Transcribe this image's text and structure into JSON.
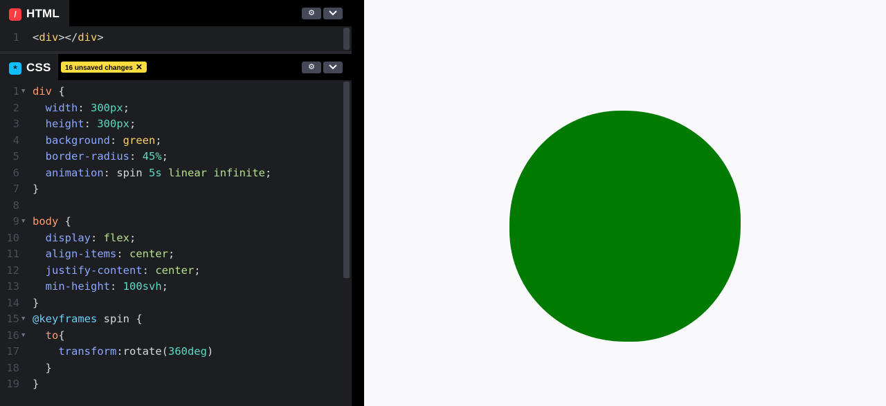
{
  "html_panel": {
    "title": "HTML",
    "icon": "html-icon",
    "lines": [
      {
        "n": "1",
        "tokens": [
          [
            "tag",
            "<"
          ],
          [
            "tagname",
            "div"
          ],
          [
            "tag",
            "></"
          ],
          [
            "tagname",
            "div"
          ],
          [
            "tag",
            ">"
          ]
        ]
      }
    ]
  },
  "css_panel": {
    "title": "CSS",
    "icon": "css-icon",
    "unsaved_label": "16 unsaved changes",
    "lines": [
      {
        "n": "1",
        "fold": true,
        "tokens": [
          [
            "sel",
            "div"
          ],
          [
            "tag",
            " {"
          ]
        ]
      },
      {
        "n": "2",
        "tokens": [
          [
            "tag",
            "  "
          ],
          [
            "prop",
            "width"
          ],
          [
            "tag",
            ": "
          ],
          [
            "num",
            "300px"
          ],
          [
            "tag",
            ";"
          ]
        ]
      },
      {
        "n": "3",
        "tokens": [
          [
            "tag",
            "  "
          ],
          [
            "prop",
            "height"
          ],
          [
            "tag",
            ": "
          ],
          [
            "num",
            "300px"
          ],
          [
            "tag",
            ";"
          ]
        ]
      },
      {
        "n": "4",
        "tokens": [
          [
            "tag",
            "  "
          ],
          [
            "prop",
            "background"
          ],
          [
            "tag",
            ": "
          ],
          [
            "val",
            "green"
          ],
          [
            "tag",
            ";"
          ]
        ]
      },
      {
        "n": "5",
        "tokens": [
          [
            "tag",
            "  "
          ],
          [
            "prop",
            "border-radius"
          ],
          [
            "tag",
            ": "
          ],
          [
            "num",
            "45%"
          ],
          [
            "tag",
            ";"
          ]
        ]
      },
      {
        "n": "6",
        "tokens": [
          [
            "tag",
            "  "
          ],
          [
            "prop",
            "animation"
          ],
          [
            "tag",
            ": spin "
          ],
          [
            "num",
            "5s"
          ],
          [
            "tag",
            " "
          ],
          [
            "kw",
            "linear"
          ],
          [
            "tag",
            " "
          ],
          [
            "kw",
            "infinite"
          ],
          [
            "tag",
            ";"
          ]
        ]
      },
      {
        "n": "7",
        "tokens": [
          [
            "tag",
            "}"
          ]
        ]
      },
      {
        "n": "8",
        "tokens": []
      },
      {
        "n": "9",
        "fold": true,
        "tokens": [
          [
            "sel",
            "body"
          ],
          [
            "tag",
            " {"
          ]
        ]
      },
      {
        "n": "10",
        "tokens": [
          [
            "tag",
            "  "
          ],
          [
            "prop",
            "display"
          ],
          [
            "tag",
            ": "
          ],
          [
            "kw",
            "flex"
          ],
          [
            "tag",
            ";"
          ]
        ]
      },
      {
        "n": "11",
        "tokens": [
          [
            "tag",
            "  "
          ],
          [
            "prop",
            "align-items"
          ],
          [
            "tag",
            ": "
          ],
          [
            "kw",
            "center"
          ],
          [
            "tag",
            ";"
          ]
        ]
      },
      {
        "n": "12",
        "tokens": [
          [
            "tag",
            "  "
          ],
          [
            "prop",
            "justify-content"
          ],
          [
            "tag",
            ": "
          ],
          [
            "kw",
            "center"
          ],
          [
            "tag",
            ";"
          ]
        ]
      },
      {
        "n": "13",
        "tokens": [
          [
            "tag",
            "  "
          ],
          [
            "prop",
            "min-height"
          ],
          [
            "tag",
            ": "
          ],
          [
            "num",
            "100svh"
          ],
          [
            "tag",
            ";"
          ]
        ]
      },
      {
        "n": "14",
        "tokens": [
          [
            "tag",
            "}"
          ]
        ]
      },
      {
        "n": "15",
        "fold": true,
        "tokens": [
          [
            "at",
            "@keyframes"
          ],
          [
            "tag",
            " spin {"
          ]
        ]
      },
      {
        "n": "16",
        "fold": true,
        "tokens": [
          [
            "tag",
            "  "
          ],
          [
            "sel",
            "to"
          ],
          [
            "tag",
            "{"
          ]
        ]
      },
      {
        "n": "17",
        "tokens": [
          [
            "tag",
            "    "
          ],
          [
            "prop",
            "transform"
          ],
          [
            "tag",
            ":rotate("
          ],
          [
            "num",
            "360deg"
          ],
          [
            "tag",
            ")"
          ]
        ]
      },
      {
        "n": "18",
        "tokens": [
          [
            "tag",
            "  }"
          ]
        ]
      },
      {
        "n": "19",
        "tokens": [
          [
            "tag",
            "}"
          ]
        ]
      }
    ]
  },
  "buttons": {
    "settings_icon": "gear-icon",
    "collapse_icon": "chevron-down-icon"
  },
  "preview": {
    "shape_color": "#007a00",
    "background": "#f9f9fb"
  }
}
